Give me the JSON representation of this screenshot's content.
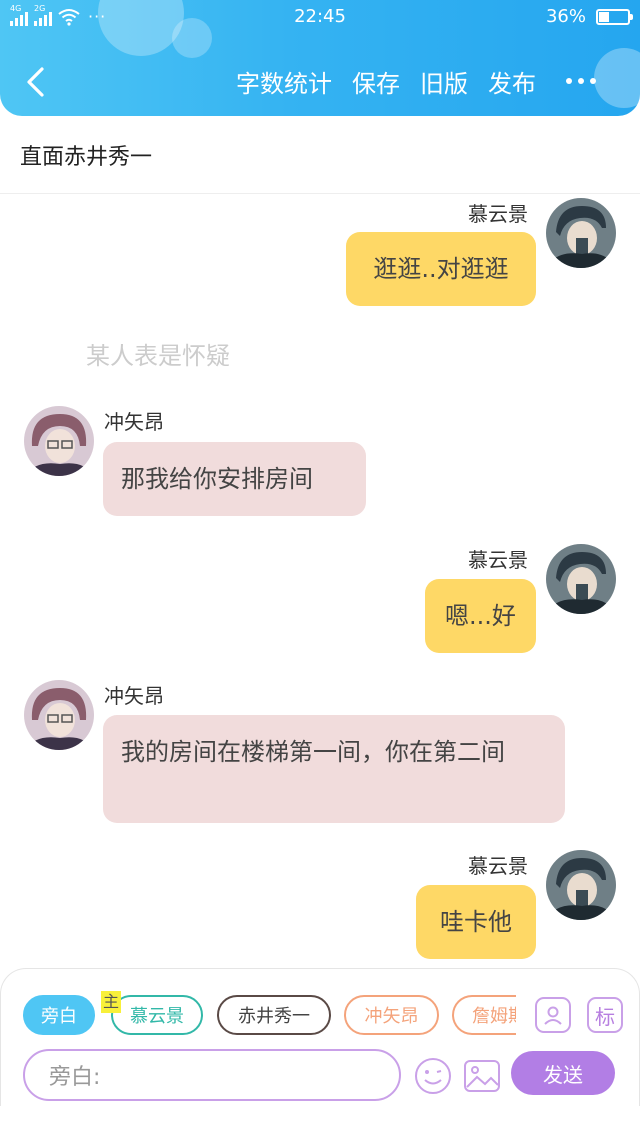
{
  "status_bar": {
    "net1": "4G",
    "net2": "2G",
    "more": "···",
    "time": "22:45",
    "battery_text": "36%",
    "battery_level": 0.36
  },
  "nav": {
    "actions": [
      "字数统计",
      "保存",
      "旧版",
      "发布"
    ]
  },
  "page": {
    "title": "直面赤井秀一"
  },
  "messages": [
    {
      "side": "right",
      "speaker": "慕云景",
      "text": "逛逛..对逛逛"
    },
    {
      "side": "narration",
      "text": "某人表是怀疑"
    },
    {
      "side": "left",
      "speaker": "冲矢昂",
      "text": "那我给你安排房间"
    },
    {
      "side": "right",
      "speaker": "慕云景",
      "text": "嗯...好"
    },
    {
      "side": "left",
      "speaker": "冲矢昂",
      "text": "我的房间在楼梯第一间，你在第二间"
    },
    {
      "side": "right",
      "speaker": "慕云景",
      "text": "哇卡他"
    }
  ],
  "composer": {
    "chips": [
      "旁白",
      "慕云景",
      "赤井秀一",
      "冲矢昂",
      "詹姆斯"
    ],
    "main_badge": "主",
    "mark_tool": "标",
    "input_placeholder": "旁白:",
    "send_label": "发送"
  },
  "colors": {
    "header": "#35b3f2",
    "right_bubble": "#fed866",
    "left_bubble": "#f1dcdc",
    "accent_purple": "#b27ee5"
  }
}
